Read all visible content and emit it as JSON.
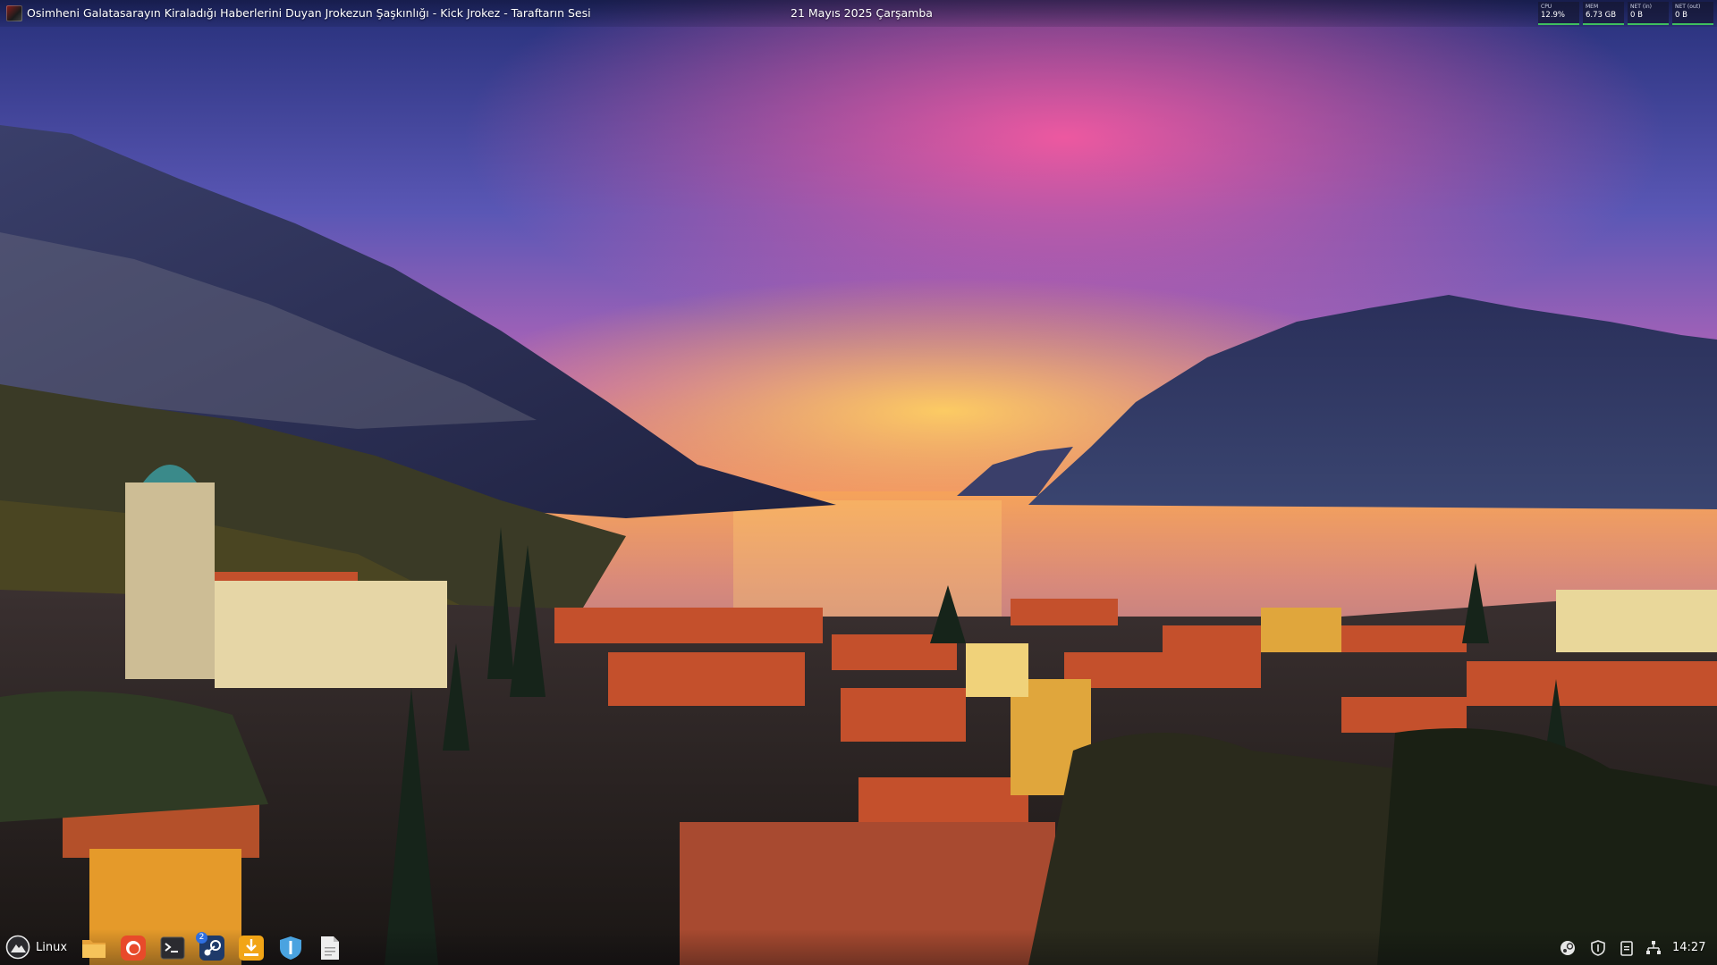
{
  "top_bar": {
    "window_title": "Osimheni Galatasarayın Kiraladığı Haberlerini Duyan Jrokezun Şaşkınlığı - Kick Jrokez - Taraftarın Sesi",
    "date": "21 Mayıs 2025 Çarşamba",
    "system_monitor": [
      {
        "label": "CPU",
        "value": "12.9%"
      },
      {
        "label": "MEM",
        "value": "6.73 GB"
      },
      {
        "label": "NET (in)",
        "value": "0 B"
      },
      {
        "label": "NET (out)",
        "value": "0 B"
      }
    ]
  },
  "panel": {
    "start_label": "Linux",
    "launchers": [
      {
        "name": "files-icon"
      },
      {
        "name": "firefox-icon"
      },
      {
        "name": "terminal-icon"
      },
      {
        "name": "steam-icon",
        "badge": "2"
      },
      {
        "name": "installer-icon"
      },
      {
        "name": "vpn-shield-icon"
      },
      {
        "name": "text-editor-icon"
      }
    ],
    "tray": [
      "steam-tray-icon",
      "shield-tray-icon",
      "clipboard-tray-icon",
      "network-tray-icon"
    ],
    "time": "14:27"
  },
  "colors": {
    "sky_top": "#2b3a8c",
    "sky_pink": "#e35a9a",
    "sky_orange": "#f39a2a",
    "lake": "#f0a56a",
    "roof": "#c4502c",
    "monitor_bar": "#3fbf5f"
  }
}
